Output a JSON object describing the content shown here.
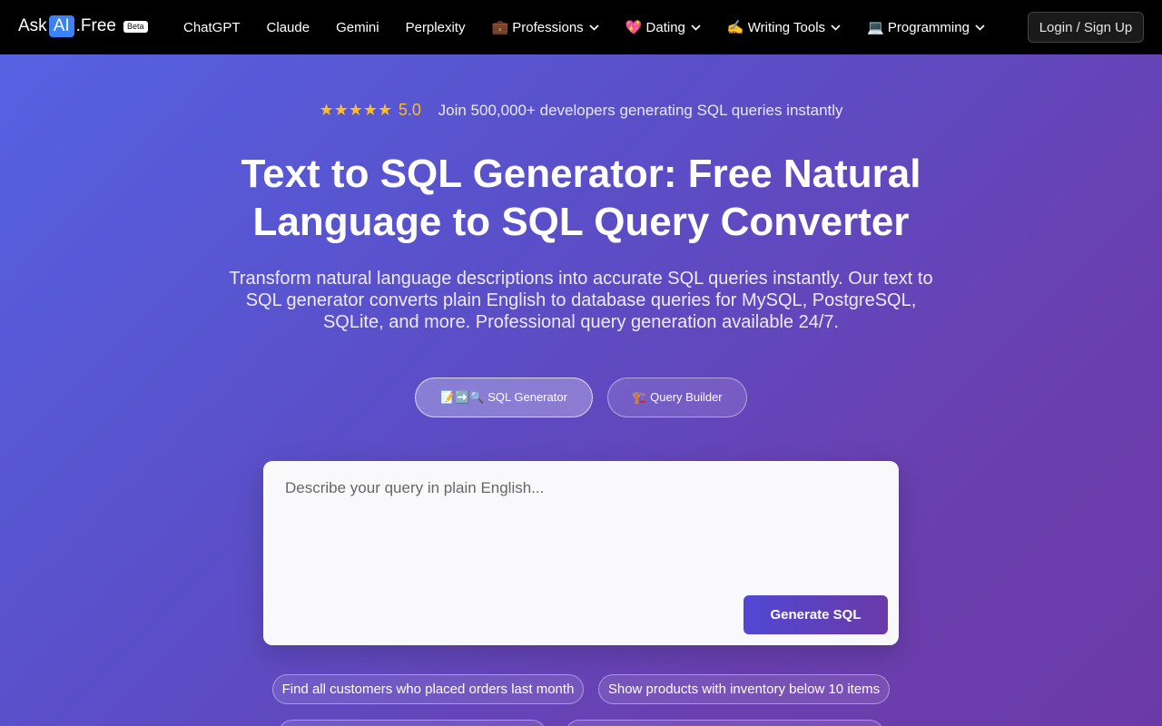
{
  "brand": {
    "prefix": "Ask",
    "highlight": "AI",
    "suffix": ".Free",
    "badge": "Beta"
  },
  "nav": {
    "links": [
      {
        "label": "ChatGPT",
        "dropdown": false
      },
      {
        "label": "Claude",
        "dropdown": false
      },
      {
        "label": "Gemini",
        "dropdown": false
      },
      {
        "label": "Perplexity",
        "dropdown": false
      },
      {
        "label": "💼 Professions",
        "dropdown": true
      },
      {
        "label": "💖 Dating",
        "dropdown": true
      },
      {
        "label": "✍️ Writing Tools",
        "dropdown": true
      },
      {
        "label": "💻 Programming",
        "dropdown": true
      }
    ],
    "login_label": "Login / Sign Up"
  },
  "hero": {
    "stars": "★★★★★",
    "score": "5.0",
    "social_proof": "Join 500,000+ developers generating SQL queries instantly",
    "title": "Text to SQL Generator: Free Natural Language to SQL Query Converter",
    "subtitle": "Transform natural language descriptions into accurate SQL queries instantly. Our text to SQL generator converts plain English to database queries for MySQL, PostgreSQL, SQLite, and more. Professional query generation available 24/7."
  },
  "tabs": [
    {
      "label": "📝➡️🔍 SQL Generator",
      "active": true
    },
    {
      "label": "🏗️ Query Builder",
      "active": false
    }
  ],
  "input": {
    "placeholder": "Describe your query in plain English...",
    "value": "",
    "submit_label": "Generate SQL"
  },
  "examples": [
    "Find all customers who placed orders last month",
    "Show products with inventory below 10 items"
  ],
  "colors": {
    "nav_bg": "#000000",
    "accent_blue": "#3b82f6",
    "star": "#fbbf24",
    "button_start": "#5147d4",
    "button_end": "#6a3aa8"
  }
}
